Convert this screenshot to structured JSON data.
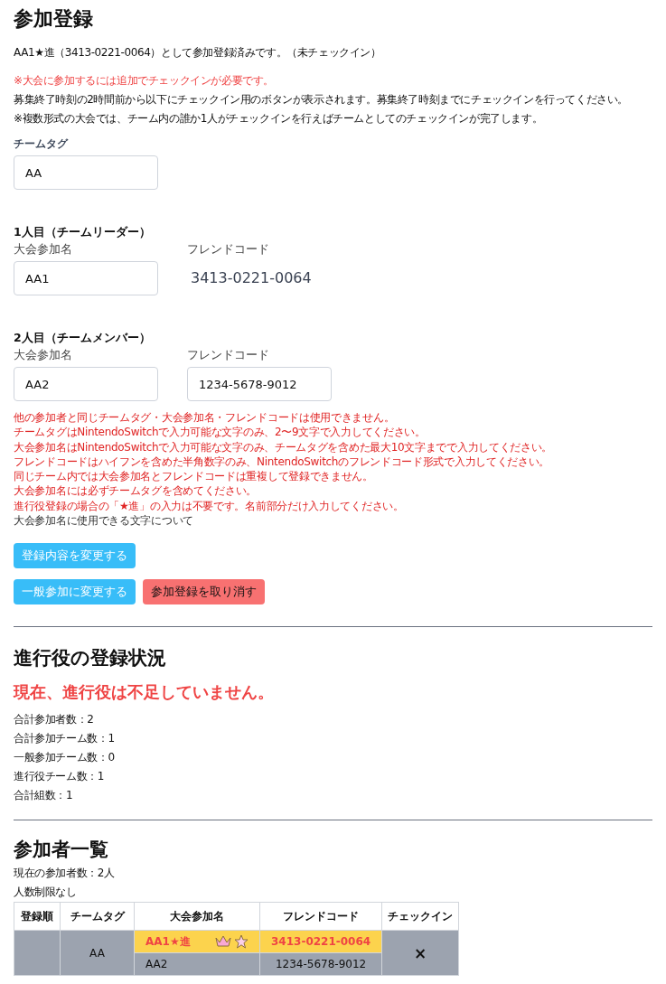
{
  "title": "参加登録",
  "status": "AA1★進（3413-0221-0064）として参加登録済みです。（未チェックイン）",
  "notices": [
    {
      "text": "※大会に参加するには追加でチェックインが必要です。",
      "kind": "warning"
    },
    {
      "text": "募集終了時刻の2時間前から以下にチェックイン用のボタンが表示されます。募集終了時刻までにチェックインを行ってください。",
      "kind": "info"
    },
    {
      "text": "※複数形式の大会では、チーム内の誰か1人がチェックインを行えばチームとしてのチェックインが完了します。",
      "kind": "info"
    }
  ],
  "team_tag": {
    "label": "チームタグ",
    "value": "AA"
  },
  "members": [
    {
      "heading": "1人目（チームリーダー）",
      "name_label": "大会参加名",
      "name": "AA1",
      "code_label": "フレンドコード",
      "code": "3413-0221-0064",
      "editable": false
    },
    {
      "heading": "2人目（チームメンバー）",
      "name_label": "大会参加名",
      "name": "AA2",
      "code_label": "フレンドコード",
      "code": "1234-5678-9012",
      "editable": true
    }
  ],
  "rules": [
    {
      "text": "他の参加者と同じチームタグ・大会参加名・フレンドコードは使用できません。",
      "kind": "warning"
    },
    {
      "text": "チームタグはNintendoSwitchで入力可能な文字のみ、2〜9文字で入力してください。",
      "kind": "warning"
    },
    {
      "text": "大会参加名はNintendoSwitchで入力可能な文字のみ、チームタグを含めた最大10文字までで入力してください。",
      "kind": "warning"
    },
    {
      "text": "フレンドコードはハイフンを含めた半角数字のみ、NintendoSwitchのフレンドコード形式で入力してください。",
      "kind": "warning"
    },
    {
      "text": "同じチーム内では大会参加名とフレンドコードは重複して登録できません。",
      "kind": "warning"
    },
    {
      "text": "大会参加名には必ずチームタグを含めてください。",
      "kind": "warning"
    },
    {
      "text": "進行役登録の場合の「★進」の入力は不要です。名前部分だけ入力してください。",
      "kind": "warning"
    },
    {
      "text": "大会参加名に使用できる文字について",
      "kind": "link"
    }
  ],
  "button_rows": [
    [
      {
        "label": "登録内容を変更する",
        "kind": "primary"
      }
    ],
    [
      {
        "label": "一般参加に変更する",
        "kind": "primary"
      },
      {
        "label": "参加登録を取り消す",
        "kind": "danger"
      }
    ]
  ],
  "staff": {
    "heading": "進行役の登録状況",
    "status": "現在、進行役は不足していません。",
    "stats": [
      "合計参加者数：2",
      "合計参加チーム数：1",
      "一般参加チーム数：0",
      "進行役チーム数：1",
      "合計組数：1"
    ]
  },
  "participants": {
    "heading": "参加者一覧",
    "count": "現在の参加者数：2人",
    "limit": "人数制限なし",
    "table": {
      "columns": [
        "登録順",
        "チームタグ",
        "大会参加名",
        "フレンドコード",
        "チェックイン"
      ],
      "teams": [
        {
          "team_tag": "AA",
          "checkin": "×",
          "members": [
            {
              "name": "AA1★進",
              "code": "3413-0221-0064",
              "highlighted": true,
              "leader": true,
              "staff": true
            },
            {
              "name": "AA2",
              "code": "1234-5678-9012",
              "highlighted": false,
              "leader": false,
              "staff": false
            }
          ]
        }
      ]
    }
  }
}
